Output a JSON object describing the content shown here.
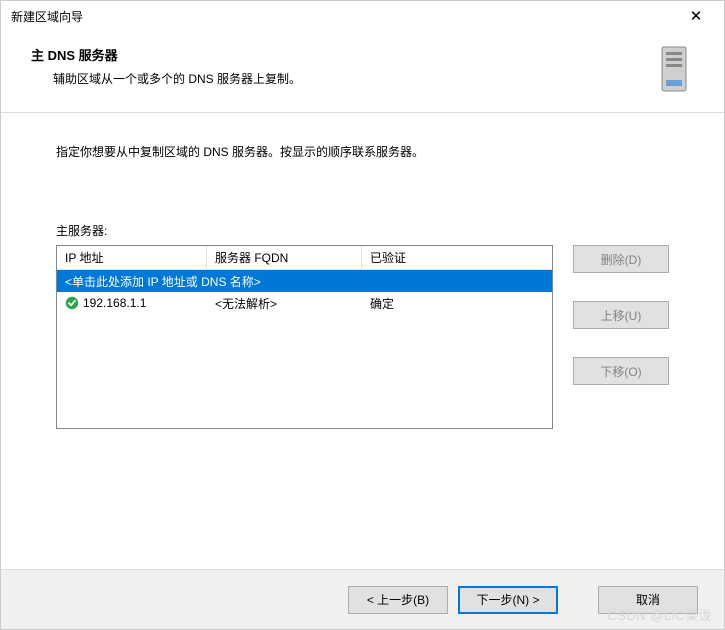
{
  "window": {
    "title": "新建区域向导",
    "close_symbol": "✕"
  },
  "header": {
    "heading": "主 DNS 服务器",
    "subtitle": "辅助区域从一个或多个的 DNS 服务器上复制。"
  },
  "body": {
    "instruction": "指定你想要从中复制区域的 DNS 服务器。按显示的顺序联系服务器。",
    "list_label": "主服务器:",
    "columns": {
      "ip": "IP 地址",
      "fqdn": "服务器 FQDN",
      "verified": "已验证"
    },
    "placeholder_row": "<单击此处添加 IP 地址或 DNS 名称>",
    "rows": [
      {
        "ip": "192.168.1.1",
        "fqdn": "<无法解析>",
        "verified": "确定",
        "status": "ok"
      }
    ],
    "buttons": {
      "delete": "删除(D)",
      "up": "上移(U)",
      "down": "下移(O)"
    }
  },
  "footer": {
    "back": "< 上一步(B)",
    "next": "下一步(N) >",
    "cancel": "取消"
  },
  "watermark": "CSDN @LiC栗泷"
}
